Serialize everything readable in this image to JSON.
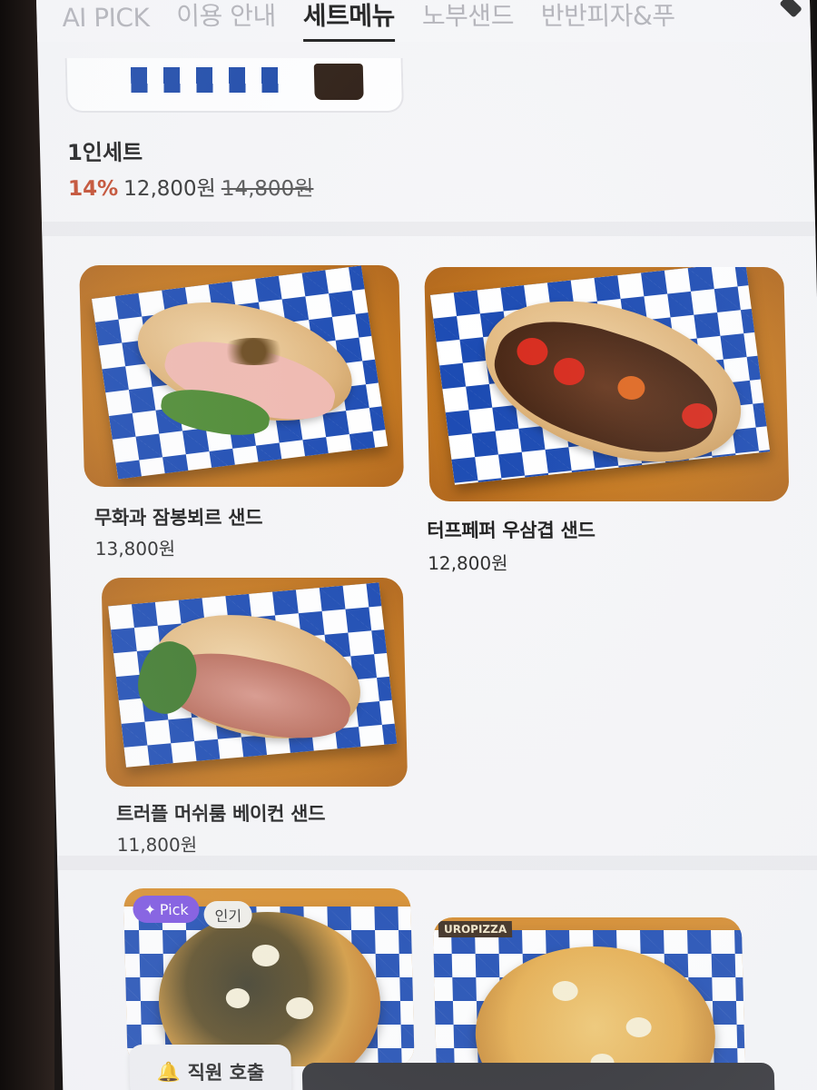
{
  "tabs": [
    {
      "label": "AI PICK",
      "active": false
    },
    {
      "label": "이용 안내",
      "active": false
    },
    {
      "label": "세트메뉴",
      "active": true
    },
    {
      "label": "노부샌드",
      "active": false
    },
    {
      "label": "반반피자&푸",
      "active": false
    }
  ],
  "set": {
    "title": "1인세트",
    "discount": "14%",
    "price": "12,800원",
    "original_price": "14,800원"
  },
  "products": [
    {
      "name": "무화과 잠봉뵈르 샌드",
      "price": "13,800원"
    },
    {
      "name": "터프페퍼 우삼겹 샌드",
      "price": "12,800원"
    },
    {
      "name": "트러플 머쉬룸 베이컨 샌드",
      "price": "11,800원"
    }
  ],
  "pizza_badges": {
    "pick": "Pick",
    "popular": "인기"
  },
  "pizza_box_text": "UROPIZZA",
  "staff_call": {
    "label": "직원 호출"
  },
  "colors": {
    "accent_discount": "#c34a2c",
    "pick_badge": "#7b52e0",
    "checker_blue": "#1c4bb3"
  }
}
